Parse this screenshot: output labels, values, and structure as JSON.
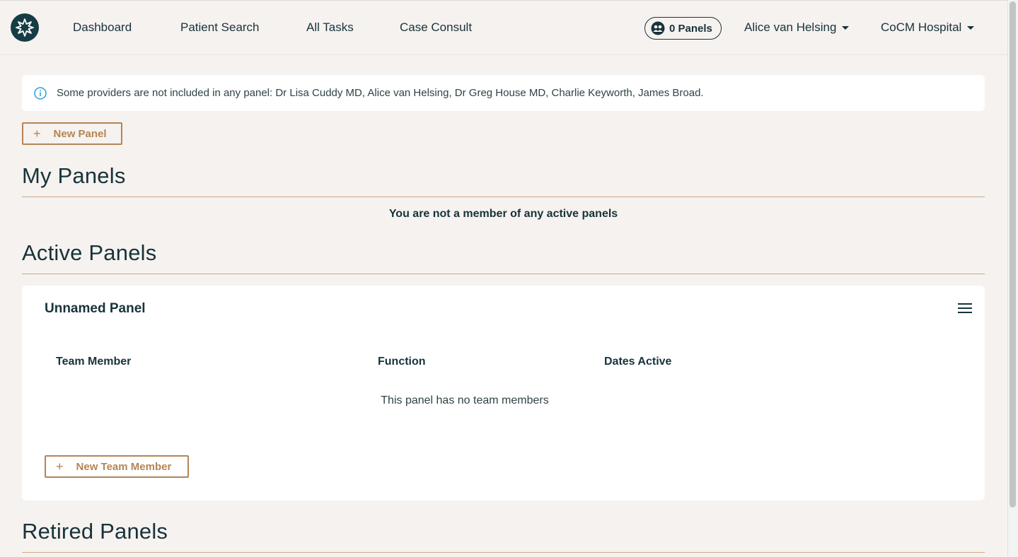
{
  "nav": {
    "links": [
      "Dashboard",
      "Patient Search",
      "All Tasks",
      "Case Consult"
    ],
    "panels_button": "0 Panels",
    "user_menu": "Alice van Helsing",
    "org_menu": "CoCM Hospital"
  },
  "info_alert": {
    "icon": "info-icon",
    "text": "Some providers are not included in any panel: Dr Lisa Cuddy MD, Alice van Helsing, Dr Greg House MD, Charlie Keyworth, James Broad."
  },
  "actions": {
    "new_panel": "New Panel",
    "plus_icon": "+"
  },
  "my_panels": {
    "title": "My Panels",
    "empty": "You are not a member of any active panels"
  },
  "active_panels": {
    "title": "Active Panels",
    "panels": [
      {
        "name": "Unnamed Panel",
        "columns": [
          "Team Member",
          "Function",
          "Dates Active"
        ],
        "empty": "This panel has no team members",
        "new_member": "New Team Member"
      }
    ]
  },
  "retired_panels": {
    "title": "Retired Panels"
  },
  "colors": {
    "primary": "#17333b",
    "accent": "#b48555",
    "background": "#f6f2ef",
    "info": "#2b9fd8"
  }
}
